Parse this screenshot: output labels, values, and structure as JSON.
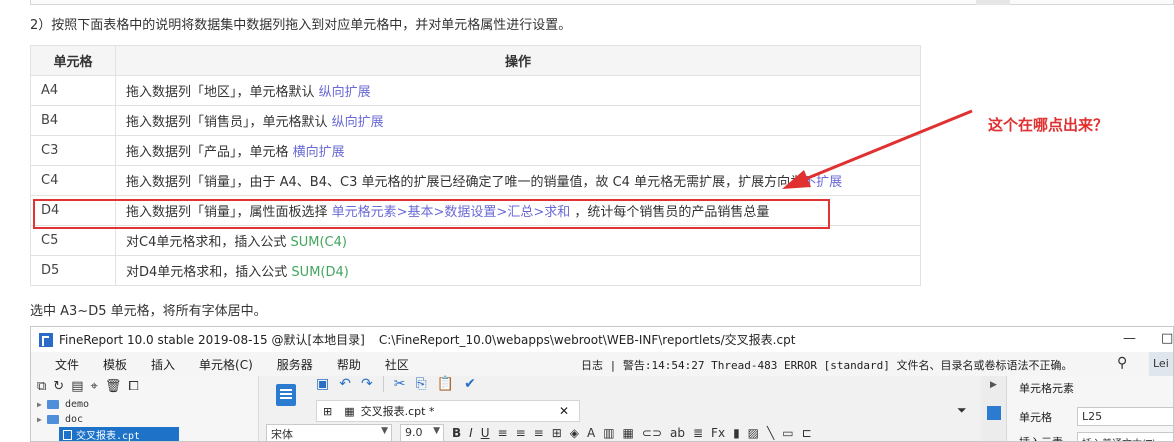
{
  "step_text": "2）按照下面表格中的说明将数据集中数据列拖入到对应单元格中，并对单元格属性进行设置。",
  "table": {
    "headers": [
      "单元格",
      "操作"
    ],
    "rows": [
      {
        "cell": "A4",
        "pre": "拖入数据列「地区」，单元格默认 ",
        "hl": "纵向扩展",
        "post": "",
        "fx": ""
      },
      {
        "cell": "B4",
        "pre": "拖入数据列「销售员」，单元格默认 ",
        "hl": "纵向扩展",
        "post": "",
        "fx": ""
      },
      {
        "cell": "C3",
        "pre": "拖入数据列「产品」，单元格 ",
        "hl": "横向扩展",
        "post": "",
        "fx": ""
      },
      {
        "cell": "C4",
        "pre": "拖入数据列「销量」，由于 A4、B4、C3 单元格的扩展已经确定了唯一的销量值，故 C4 单元格无需扩展，扩展方向为",
        "hl": "不扩展",
        "post": "",
        "fx": ""
      },
      {
        "cell": "D4",
        "pre": "拖入数据列「销量」，属性面板选择 ",
        "hl": "单元格元素>基本>数据设置>汇总>求和",
        "post": " ，统计每个销售员的产品销售总量",
        "fx": ""
      },
      {
        "cell": "C5",
        "pre": "对C4单元格求和，插入公式 ",
        "hl": "",
        "post": "",
        "fx": "SUM(C4)"
      },
      {
        "cell": "D5",
        "pre": "对D4单元格求和，插入公式 ",
        "hl": "",
        "post": "",
        "fx": "SUM(D4)"
      }
    ]
  },
  "annotation": "这个在哪点出来？",
  "note_text": "选中 A3~D5 单元格，将所有字体居中。",
  "colors": {
    "highlight": "#6a6ad6",
    "formula": "#42a65f",
    "annotation_red": "#e03030",
    "brand_blue": "#2b7bd0"
  },
  "app": {
    "title": "FineReport 10.0 stable 2019-08-15 @默认[本地目录]",
    "path": "C:\\FineReport_10.0\\webapps\\webroot\\WEB-INF\\reportlets/交叉报表.cpt",
    "window_controls": [
      "—",
      "□"
    ],
    "menu": [
      "文件",
      "模板",
      "插入",
      "单元格(C)",
      "服务器",
      "帮助",
      "社区"
    ],
    "log": "日志 | 警告:14:54:27 Thread-483 ERROR [standard] 文件名、目录名或卷标语法不正确。",
    "user": "Lei",
    "tree": [
      {
        "label": "demo",
        "type": "folder"
      },
      {
        "label": "doc",
        "type": "folder"
      },
      {
        "label": "交叉报表.cpt",
        "type": "file",
        "selected": true
      }
    ],
    "tab_label": "交叉报表.cpt *",
    "font_name": "宋体",
    "font_size": "9.0",
    "format_buttons": [
      "B",
      "I",
      "U"
    ],
    "right_panel": {
      "header": "单元格元素",
      "cell_label": "单元格",
      "cell_value": "L25",
      "insert_label": "插入元素",
      "insert_value": "插入普通文本(T)"
    }
  }
}
